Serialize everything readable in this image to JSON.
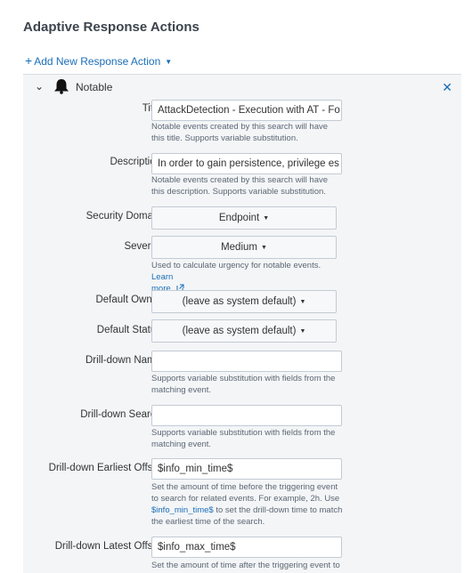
{
  "heading": "Adaptive Response Actions",
  "add_action": {
    "label": "Add New Response Action"
  },
  "panel": {
    "title": "Notable"
  },
  "fields": {
    "title": {
      "label": "Title",
      "value": "AttackDetection - Execution with AT - Fo",
      "help": "Notable events created by this search will have this title. Supports variable substitution."
    },
    "description": {
      "label": "Description",
      "value": "In order to gain persistence, privilege es",
      "help": "Notable events created by this search will have this description. Supports variable substitution."
    },
    "security_domain": {
      "label": "Security Domain",
      "value": "Endpoint"
    },
    "severity": {
      "label": "Severity",
      "value": "Medium",
      "help": "Used to calculate urgency for notable events.",
      "help_link_part1": "Learn",
      "help_link_part2": "more"
    },
    "default_owner": {
      "label": "Default Owner",
      "value": "(leave as system default)"
    },
    "default_status": {
      "label": "Default Status",
      "value": "(leave as system default)"
    },
    "drilldown_name": {
      "label": "Drill-down Name",
      "value": "",
      "help": "Supports variable substitution with fields from the matching event."
    },
    "drilldown_search": {
      "label": "Drill-down Search",
      "value": "",
      "help": "Supports variable substitution with fields from the matching event."
    },
    "drilldown_earliest": {
      "label": "Drill-down Earliest Offset",
      "value": "$info_min_time$",
      "help_pre": "Set the amount of time before the triggering event to search for related events. For example, 2h. Use",
      "help_link": "$info_min_time$",
      "help_post": "to set the drill-down time to match the earliest time of the search."
    },
    "drilldown_latest": {
      "label": "Drill-down Latest Offset",
      "value": "$info_max_time$",
      "help": "Set the amount of time after the triggering event to"
    }
  }
}
